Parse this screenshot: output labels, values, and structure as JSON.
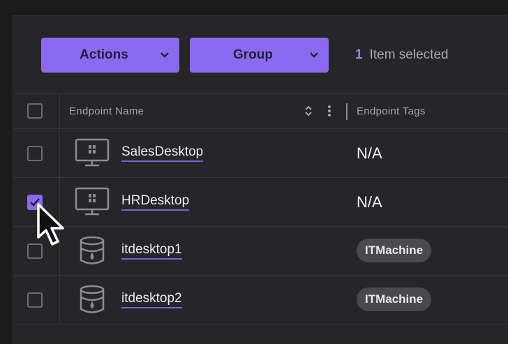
{
  "toolbar": {
    "actions_label": "Actions",
    "group_label": "Group",
    "selected_count": "1",
    "selected_text": "Item selected"
  },
  "table": {
    "columns": {
      "name": "Endpoint Name",
      "tags": "Endpoint Tags"
    },
    "rows": [
      {
        "name": "SalesDesktop",
        "tag": "N/A",
        "tag_style": "text",
        "device_icon": "windows-monitor-icon",
        "checked": false
      },
      {
        "name": "HRDesktop",
        "tag": "N/A",
        "tag_style": "text",
        "device_icon": "windows-monitor-icon",
        "checked": true
      },
      {
        "name": "itdesktop1",
        "tag": "ITMachine",
        "tag_style": "pill",
        "device_icon": "database-icon",
        "checked": false
      },
      {
        "name": "itdesktop2",
        "tag": "ITMachine",
        "tag_style": "pill",
        "device_icon": "database-icon",
        "checked": false
      }
    ]
  },
  "colors": {
    "accent": "#8a6bf0",
    "background": "#1b1b1c",
    "panel": "#262628",
    "pill": "#4a4a4e"
  }
}
